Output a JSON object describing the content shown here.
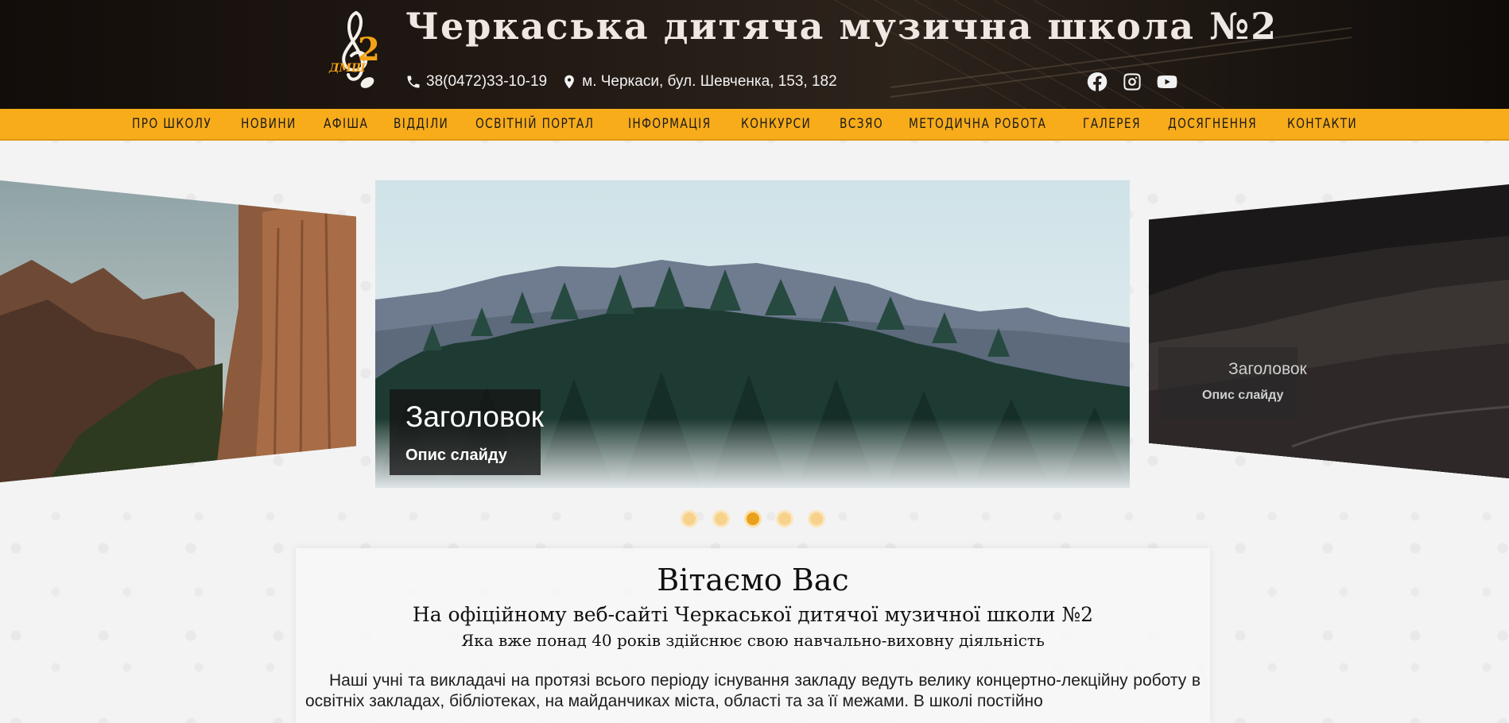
{
  "header": {
    "logo_text": "ДМШ",
    "logo_number": "2",
    "title": "Черкаська дитяча музична школа №2",
    "phone": "38(0472)33-10-19",
    "address": "м. Черкаси, бул. Шевченка, 153, 182",
    "socials": [
      "facebook-icon",
      "instagram-icon",
      "youtube-icon"
    ]
  },
  "nav": {
    "items": [
      "ПРО ШКОЛУ",
      "НОВИНИ",
      "АФІША",
      "ВІДДІЛИ",
      "ОСВІТНІЙ ПОРТАЛ",
      "ІНФОРМАЦІЯ",
      "КОНКУРСИ",
      "ВСЗЯО",
      "МЕТОДИЧНА РОБОТА",
      "ГАЛЕРЕЯ",
      "ДОСЯГНЕННЯ",
      "КОНТАКТИ"
    ]
  },
  "carousel": {
    "main_caption_title": "Заголовок",
    "main_caption_desc": "Опис слайду",
    "right_caption_title": "Заголовок",
    "right_caption_desc": "Опис слайду",
    "dot_count": 5,
    "active_dot": 3
  },
  "welcome": {
    "title": "Вітаємо Вас",
    "subtitle": "На офіційному веб-сайті Черкаської дитячої музичної школи №2",
    "subtitle2": "Яка вже понад 40 років здійснює свою навчально-виховну діяльність",
    "body": "Наші учні та викладачі на протязі всього періоду існування закладу ведуть велику концертно-лекційну роботу в освітніх закладах, бібліотеках, на майданчиках міста, області та за її межами. В школі постійно"
  },
  "colors": {
    "accent": "#f8ac1a",
    "header_bg": "#1a1410",
    "dot_active": "#eaa11a"
  }
}
